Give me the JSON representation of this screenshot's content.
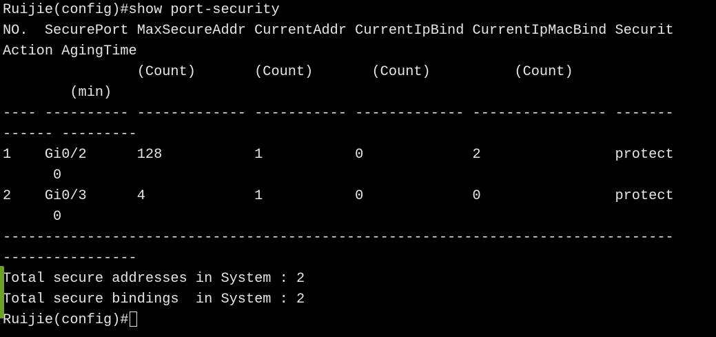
{
  "terminal": {
    "lines": [
      "Ruijie(config)#show port-security",
      "NO.  SecurePort MaxSecureAddr CurrentAddr CurrentIpBind CurrentIpMacBind Securit",
      "Action AgingTime",
      "                (Count)       (Count)       (Count)          (Count)",
      "        (min)",
      "---- ---------- ------------- ----------- ------------- ---------------- -------",
      "------ ---------",
      "1    Gi0/2      128           1           0             2                protect",
      "      0",
      "2    Gi0/3      4             1           0             0                protect",
      "      0",
      "--------------------------------------------------------------------------------",
      "----------------",
      "Total secure addresses in System : 2",
      "Total secure bindings  in System : 2"
    ],
    "prompt": "Ruijie(config)#"
  },
  "colors": {
    "background": "#000000",
    "foreground": "#e6e6e6",
    "edge_marker": "#6aa126"
  }
}
